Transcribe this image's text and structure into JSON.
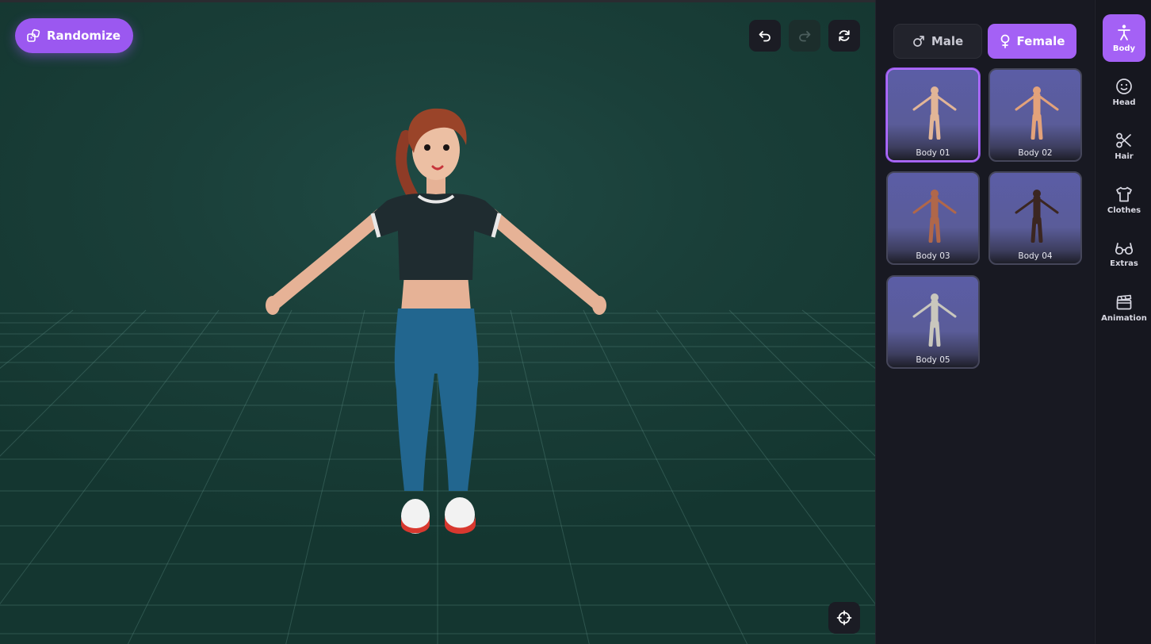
{
  "toolbar": {
    "randomize_label": "Randomize",
    "undo_icon": "undo-icon",
    "redo_icon": "redo-icon",
    "reset_icon": "refresh-icon",
    "recenter_icon": "crosshair-icon"
  },
  "gender": {
    "male_label": "Male",
    "female_label": "Female",
    "selected": "Female"
  },
  "bodies": [
    {
      "label": "Body 01",
      "skin": "#e2b597",
      "selected": true
    },
    {
      "label": "Body 02",
      "skin": "#e3a27a",
      "selected": false
    },
    {
      "label": "Body 03",
      "skin": "#b0674a",
      "selected": false
    },
    {
      "label": "Body 04",
      "skin": "#3b2621",
      "selected": false
    },
    {
      "label": "Body 05",
      "skin": "#c9c7bd",
      "selected": false
    }
  ],
  "categories": [
    {
      "label": "Body",
      "icon": "person-icon",
      "active": true
    },
    {
      "label": "Head",
      "icon": "smiley-icon",
      "active": false
    },
    {
      "label": "Hair",
      "icon": "scissors-icon",
      "active": false
    },
    {
      "label": "Clothes",
      "icon": "shirt-icon",
      "active": false
    },
    {
      "label": "Extras",
      "icon": "glasses-icon",
      "active": false
    },
    {
      "label": "Animation",
      "icon": "clapperboard-icon",
      "active": false
    }
  ],
  "colors": {
    "accent": "#a461f5",
    "viewport_bg": "#1a3f39",
    "panel_bg": "#181922"
  }
}
